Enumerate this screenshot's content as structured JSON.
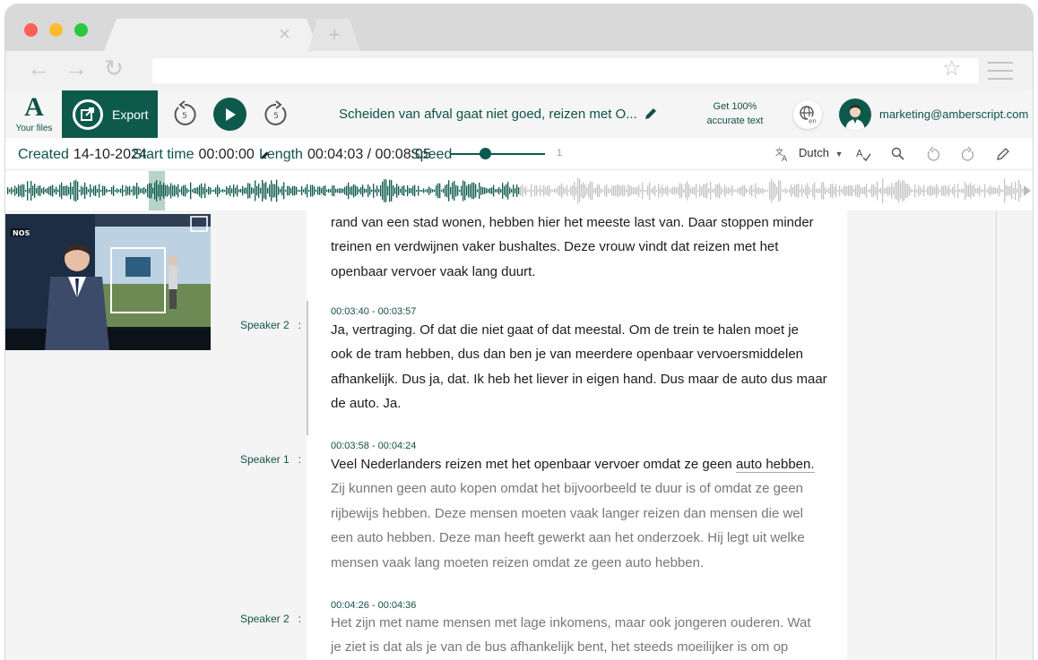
{
  "browser": {
    "tab_close": "×",
    "new_tab": "+"
  },
  "toolbar": {
    "your_files": "Your files",
    "export_label": "Export",
    "skip_back_seconds": "5",
    "skip_forward_seconds": "5",
    "title": "Scheiden van afval gaat niet goed, reizen met O...",
    "accurate_line1": "Get 100%",
    "accurate_line2": "accurate text",
    "globe_lang": "en",
    "user_email": "marketing@amberscript.com"
  },
  "info": {
    "created_label": "Created",
    "created_value": "14-10-2024",
    "start_label": "Start time",
    "start_value": "00:00:00",
    "length_label": "Length",
    "length_value": "00:04:03 / 00:08:05",
    "speed_label": "Speed",
    "speed_value": "1",
    "speed_fraction": 0.36,
    "language": "Dutch"
  },
  "playback": {
    "progress_fraction": 0.5
  },
  "video": {
    "channel_logo": "NOS"
  },
  "transcript": {
    "intro": {
      "lines": [
        "rand van een stad wonen, hebben hier het meeste last van. Daar stoppen minder",
        "treinen en verdwijnen vaker bushaltes. Deze vrouw vindt dat reizen met het",
        "openbaar vervoer vaak lang duurt."
      ]
    },
    "p1": {
      "speaker": "Speaker 2",
      "time": "00:03:40 - 00:03:57",
      "lines": [
        "Ja, vertraging. Of dat die niet gaat of dat meestal. Om de trein te halen moet je",
        "ook de tram hebben, dus dan ben je van meerdere openbaar vervoersmiddelen",
        "afhankelijk. Dus ja, dat. Ik heb het liever in eigen hand. Dus maar de auto dus maar",
        "de auto. Ja."
      ]
    },
    "p2": {
      "speaker": "Speaker 1",
      "time": "00:03:58 - 00:04:24",
      "line1_pre": "Veel Nederlanders reizen met het openbaar vervoer omdat ze geen ",
      "line1_highlight": "auto hebben.",
      "grey_lines": [
        "Zij kunnen geen auto kopen omdat het bijvoorbeeld te duur is of omdat ze geen",
        "rijbewijs hebben. Deze mensen moeten vaak langer reizen dan mensen die wel",
        "een auto hebben. Deze man heeft gewerkt aan het onderzoek. Hij legt uit welke",
        "mensen vaak lang moeten reizen omdat ze geen auto hebben."
      ]
    },
    "p3": {
      "speaker": "Speaker 2",
      "time": "00:04:26 - 00:04:36",
      "lines": [
        "Het zijn met name mensen met lage inkomens, maar ook jongeren ouderen. Wat",
        "je ziet is dat als je van de bus afhankelijk bent, het steeds moeilijker is om op"
      ]
    },
    "colon": ":"
  },
  "colors": {
    "brand": "#0d5a4d",
    "wave_played": "#0d5a4d",
    "wave_unplayed": "#c4c4c4"
  }
}
